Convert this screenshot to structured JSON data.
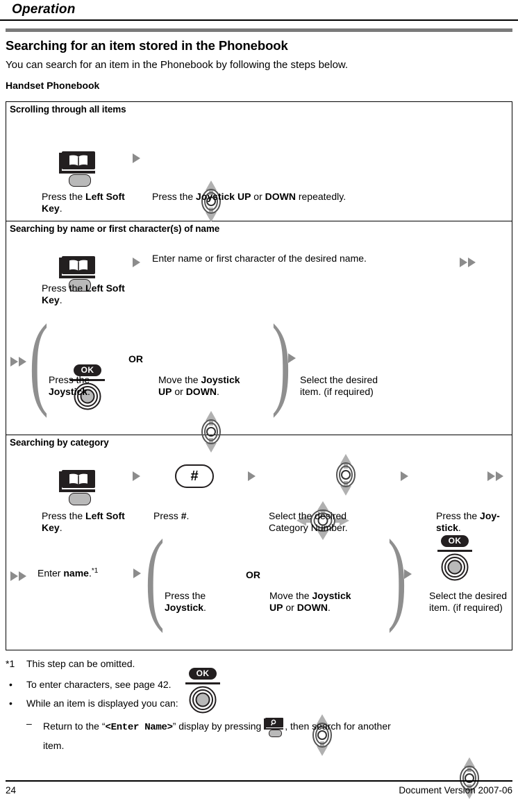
{
  "header": {
    "running_head": "Operation"
  },
  "intro": {
    "heading": "Searching for an item stored in the Phonebook",
    "paragraph": "You can search for an item in the Phonebook by following the steps below.",
    "subheading": "Handset Phonebook"
  },
  "sections": [
    {
      "title": "Scrolling through all items",
      "step1_caption_a": "Press the ",
      "step1_caption_b": "Left Soft Key",
      "step1_caption_c": ".",
      "step2_a": "Press the ",
      "step2_b": "Joystick UP",
      "step2_c": " or ",
      "step2_d": "DOWN",
      "step2_e": " repeatedly."
    },
    {
      "title": "Searching by name or first character(s) of name",
      "step1_caption_a": "Press the ",
      "step1_caption_b": "Left Soft Key",
      "step1_caption_c": ".",
      "step2_text": "Enter name or first character of the desired name.",
      "or_label": "OR",
      "branch_a_a": "Press the ",
      "branch_a_b": "Joystick",
      "branch_a_c": ".",
      "branch_b_a": "Move the ",
      "branch_b_b": "Joystick",
      "branch_b_c": "UP",
      "branch_b_d": " or ",
      "branch_b_e": "DOWN",
      "branch_b_f": ".",
      "final_line1": "Select the desired",
      "final_line2": "item. (if required)"
    },
    {
      "title": "Searching by category",
      "step1_a": "Press the ",
      "step1_b": "Left Soft Key",
      "step1_c": ".",
      "step2_a": "Press ",
      "step2_b": "#",
      "step2_c": ".",
      "step3_line1": "Select the desired",
      "step3_line2": "Category Number.",
      "step4_a": "Press the ",
      "step4_b": "Joy-",
      "step4_c": "stick",
      "step4_d": ".",
      "step5_a": "Enter ",
      "step5_b": "name",
      "step5_c": ".",
      "step5_sup": "*1",
      "or_label": "OR",
      "branch_a_a": "Press the ",
      "branch_a_b": "Joystick",
      "branch_a_c": ".",
      "branch_b_a": "Move the ",
      "branch_b_b": "Joystick",
      "branch_b_c": "UP",
      "branch_b_d": " or ",
      "branch_b_e": "DOWN",
      "branch_b_f": ".",
      "final_line1": "Select the desired",
      "final_line2": "item. (if required)"
    }
  ],
  "icons": {
    "ok_label": "OK",
    "hash_label": "#",
    "phonebook": "phonebook-soft-key-icon",
    "joystick_updown": "joystick-up-down-icon",
    "joystick_4way": "joystick-four-way-icon",
    "search_soft_key": "search-soft-key-icon"
  },
  "notes": {
    "footnote_marker": "*1",
    "footnote_text": "This step can be omitted.",
    "bullet1": "To enter characters, see page 42.",
    "bullet2": "While an item is displayed you can:",
    "dash_pre": "Return to the “",
    "dash_mono": "<Enter Name>",
    "dash_mid": "” display by pressing ",
    "dash_post": ", then search for another",
    "dash_line2": "item.",
    "bullet_glyph": "•",
    "dash_glyph": "–"
  },
  "footer": {
    "page_number": "24",
    "document_version": "Document Version 2007-06"
  },
  "colors": {
    "rule_gray": "#7a7a7a",
    "arrow_gray": "#8c8c8c",
    "icon_black": "#231f20",
    "key_gray": "#b9b9b9"
  }
}
